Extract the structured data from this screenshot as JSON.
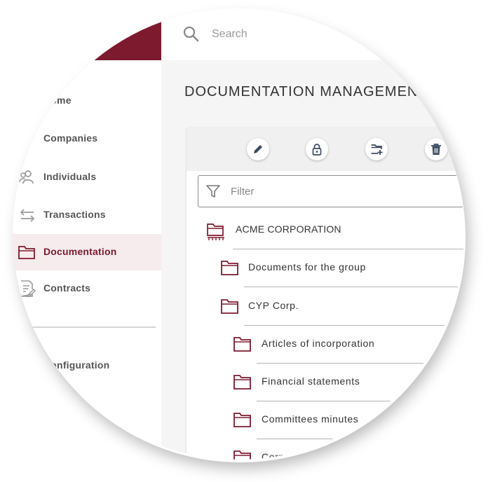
{
  "search": {
    "placeholder": "Search"
  },
  "sidebar": {
    "items": [
      {
        "label": "Home"
      },
      {
        "label": "Companies"
      },
      {
        "label": "Individuals"
      },
      {
        "label": "Transactions"
      },
      {
        "label": "Documentation"
      },
      {
        "label": "Contracts"
      },
      {
        "label": "Configuration"
      }
    ]
  },
  "page": {
    "title": "DOCUMENTATION MANAGEMENT"
  },
  "toolbar": {
    "buttons": [
      "pencil-icon",
      "lock-icon",
      "folder-add-icon",
      "trash-icon"
    ]
  },
  "filter": {
    "placeholder": "Filter"
  },
  "tree": [
    {
      "label": "ACME CORPORATION"
    },
    {
      "label": "Documents for the group"
    },
    {
      "label": "CYP Corp."
    },
    {
      "label": "Articles of incorporation"
    },
    {
      "label": "Financial statements"
    },
    {
      "label": "Committees minutes"
    },
    {
      "label": "Corporate documents"
    }
  ],
  "colors": {
    "accent": "#7e1a2e",
    "active_bg": "#f6ebed",
    "main_bg": "#f5f5f5"
  }
}
